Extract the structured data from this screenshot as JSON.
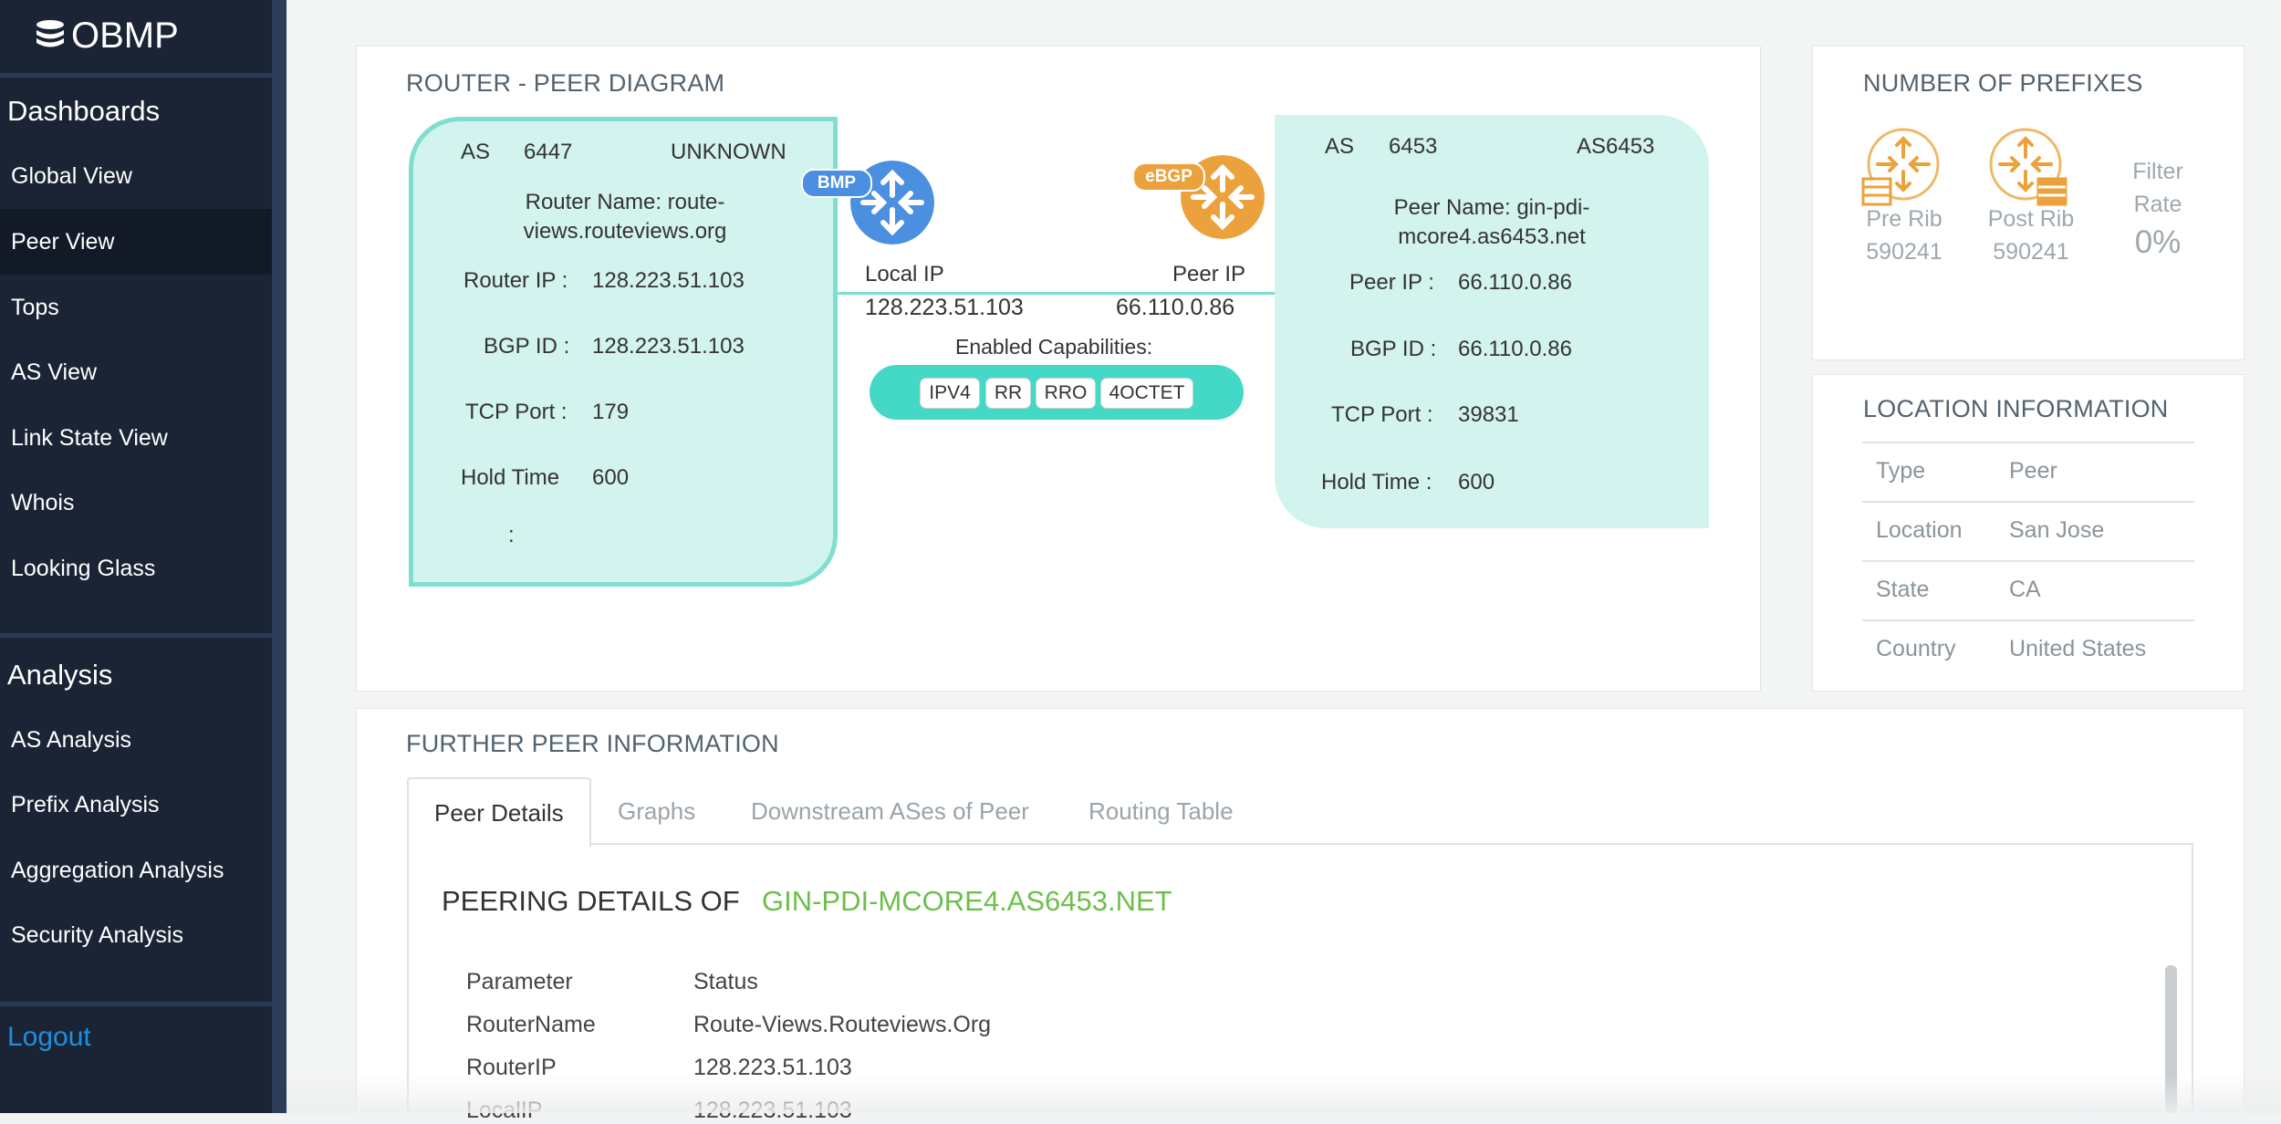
{
  "app": {
    "logo_text": "OBMP"
  },
  "sidebar": {
    "dashboards_heading": "Dashboards",
    "dashboards": [
      {
        "label": "Global View"
      },
      {
        "label": "Peer View",
        "active": true
      },
      {
        "label": "Tops"
      },
      {
        "label": "AS View"
      },
      {
        "label": "Link State View"
      },
      {
        "label": "Whois"
      },
      {
        "label": "Looking Glass"
      }
    ],
    "analysis_heading": "Analysis",
    "analysis": [
      {
        "label": "AS Analysis"
      },
      {
        "label": "Prefix Analysis"
      },
      {
        "label": "Aggregation Analysis"
      },
      {
        "label": "Security Analysis"
      }
    ],
    "logout_label": "Logout"
  },
  "diagram": {
    "title": "ROUTER - PEER DIAGRAM",
    "router": {
      "as_label": "AS",
      "as_number": "6447",
      "as_name": "UNKNOWN",
      "name_line1": "Router Name: route-",
      "name_line2": "views.routeviews.org",
      "ip_label": "Router IP :",
      "ip": "128.223.51.103",
      "bgp_id_label": "BGP ID :",
      "bgp_id": "128.223.51.103",
      "tcp_port_label": "TCP Port :",
      "tcp_port": "179",
      "hold_time_label": "Hold Time",
      "hold_time": "600",
      "colon": ":"
    },
    "link": {
      "router_badge": "BMP",
      "peer_badge": "eBGP",
      "local_ip_label": "Local IP",
      "local_ip": "128.223.51.103",
      "peer_ip_label": "Peer IP",
      "peer_ip": "66.110.0.86",
      "capabilities_label": "Enabled Capabilities:",
      "capabilities": [
        "IPV4",
        "RR",
        "RRO",
        "4OCTET"
      ]
    },
    "peer": {
      "as_label": "AS",
      "as_number": "6453",
      "as_name": "AS6453",
      "name_line1": "Peer Name: gin-pdi-",
      "name_line2": "mcore4.as6453.net",
      "ip_label": "Peer IP :",
      "ip": "66.110.0.86",
      "bgp_id_label": "BGP ID :",
      "bgp_id": "66.110.0.86",
      "tcp_port_label": "TCP Port :",
      "tcp_port": "39831",
      "hold_time_label": "Hold Time :",
      "hold_time": "600"
    },
    "colors": {
      "router_icon": "#4a8fe0",
      "peer_icon": "#eca23c",
      "box_fill": "#d3f3ee",
      "accent": "#44d8c6"
    }
  },
  "prefixes": {
    "title": "NUMBER OF PREFIXES",
    "pre_rib_label": "Pre Rib",
    "pre_rib_value": "590241",
    "post_rib_label": "Post Rib",
    "post_rib_value": "590241",
    "filter_label_1": "Filter",
    "filter_label_2": "Rate",
    "filter_value": "0%"
  },
  "location": {
    "title": "LOCATION INFORMATION",
    "rows": [
      {
        "key": "Type",
        "value": "Peer"
      },
      {
        "key": "Location",
        "value": "San Jose"
      },
      {
        "key": "State",
        "value": "CA"
      },
      {
        "key": "Country",
        "value": "United States"
      }
    ]
  },
  "further": {
    "title": "FURTHER PEER INFORMATION",
    "tabs": [
      {
        "label": "Peer Details",
        "active": true
      },
      {
        "label": "Graphs"
      },
      {
        "label": "Downstream ASes of Peer"
      },
      {
        "label": "Routing Table"
      }
    ],
    "heading_prefix": "PEERING DETAILS OF",
    "heading_peer": "GIN-PDI-MCORE4.AS6453.NET",
    "table": {
      "columns": [
        "Parameter",
        "Status"
      ],
      "rows": [
        [
          "RouterName",
          "Route-Views.Routeviews.Org"
        ],
        [
          "RouterIP",
          "128.223.51.103"
        ],
        [
          "LocalIP",
          "128.223.51.103"
        ]
      ]
    },
    "heading_peer_color": "#6cc04a"
  }
}
